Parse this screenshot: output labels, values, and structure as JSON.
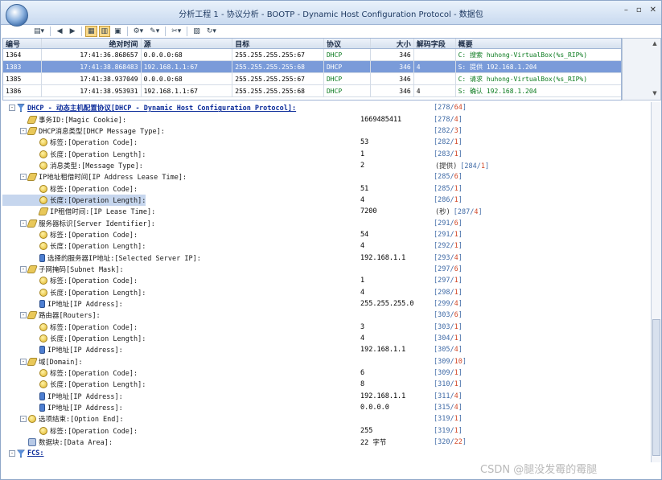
{
  "window": {
    "title": "分析工程 1 - 协议分析 - BOOTP - Dynamic Host Configuration Protocol - 数据包"
  },
  "packet_list": {
    "columns": [
      "编号",
      "绝对时间",
      "源",
      "目标",
      "协议",
      "大小",
      "解码字段",
      "概要"
    ],
    "rows": [
      {
        "no": "1364",
        "time": "17:41:36.868657",
        "src": "0.0.0.0:68",
        "dst": "255.255.255.255:67",
        "proto": "DHCP",
        "size": "346",
        "decode": "",
        "summary": "C: 搜索 huhong-VirtualBox(%s_RIP%)"
      },
      {
        "no": "1383",
        "time": "17:41:38.868483",
        "src": "192.168.1.1:67",
        "dst": "255.255.255.255:68",
        "proto": "DHCP",
        "size": "346",
        "decode": "4",
        "summary": "S: 提供 192.168.1.204",
        "selected": true
      },
      {
        "no": "1385",
        "time": "17:41:38.937049",
        "src": "0.0.0.0:68",
        "dst": "255.255.255.255:67",
        "proto": "DHCP",
        "size": "346",
        "decode": "",
        "summary": "C: 请求 huhong-VirtualBox(%s_RIP%)"
      },
      {
        "no": "1386",
        "time": "17:41:38.953931",
        "src": "192.168.1.1:67",
        "dst": "255.255.255.255:68",
        "proto": "DHCP",
        "size": "346",
        "decode": "4",
        "summary": "S: 确认 192.168.1.204"
      }
    ]
  },
  "tree": [
    {
      "lvl": 0,
      "exp": "-",
      "icon": "proto",
      "name": "DHCP - 动态主机配置协议[DHCP - Dynamic Host Configuration Protocol]:",
      "val": "",
      "unit": "",
      "off": "278",
      "len": "64",
      "top": true
    },
    {
      "lvl": 1,
      "exp": "",
      "icon": "tag",
      "name": "事务ID:[Magic Cookie]:",
      "val": "1669485411",
      "unit": "",
      "off": "278",
      "len": "4"
    },
    {
      "lvl": 1,
      "exp": "-",
      "icon": "tag",
      "name": "DHCP消息类型[DHCP Message Type]:",
      "val": "",
      "unit": "",
      "off": "282",
      "len": "3"
    },
    {
      "lvl": 2,
      "exp": "",
      "icon": "ball",
      "name": "标签:[Operation Code]:",
      "val": "53",
      "unit": "",
      "off": "282",
      "len": "1"
    },
    {
      "lvl": 2,
      "exp": "",
      "icon": "ball",
      "name": "长度:[Operation Length]:",
      "val": "1",
      "unit": "",
      "off": "283",
      "len": "1"
    },
    {
      "lvl": 2,
      "exp": "",
      "icon": "ball",
      "name": "消息类型:[Message Type]:",
      "val": "2",
      "unit": "(提供)",
      "off": "284",
      "len": "1"
    },
    {
      "lvl": 1,
      "exp": "-",
      "icon": "tag",
      "name": "IP地址租借时间[IP Address Lease Time]:",
      "val": "",
      "unit": "",
      "off": "285",
      "len": "6"
    },
    {
      "lvl": 2,
      "exp": "",
      "icon": "ball",
      "name": "标签:[Operation Code]:",
      "val": "51",
      "unit": "",
      "off": "285",
      "len": "1"
    },
    {
      "lvl": 2,
      "exp": "",
      "icon": "ball",
      "name": "长度:[Operation Length]:",
      "val": "4",
      "unit": "",
      "off": "286",
      "len": "1",
      "hl": true
    },
    {
      "lvl": 2,
      "exp": "",
      "icon": "tag",
      "name": "IP租借时间:[IP Lease Time]:",
      "val": "7200",
      "unit": "(秒)",
      "off": "287",
      "len": "4"
    },
    {
      "lvl": 1,
      "exp": "-",
      "icon": "tag",
      "name": "服务器标识[Server Identifier]:",
      "val": "",
      "unit": "",
      "off": "291",
      "len": "6"
    },
    {
      "lvl": 2,
      "exp": "",
      "icon": "ball",
      "name": "标签:[Operation Code]:",
      "val": "54",
      "unit": "",
      "off": "291",
      "len": "1"
    },
    {
      "lvl": 2,
      "exp": "",
      "icon": "ball",
      "name": "长度:[Operation Length]:",
      "val": "4",
      "unit": "",
      "off": "292",
      "len": "1"
    },
    {
      "lvl": 2,
      "exp": "",
      "icon": "ip",
      "name": "选择的服务器IP地址:[Selected Server IP]:",
      "val": "192.168.1.1",
      "unit": "",
      "off": "293",
      "len": "4"
    },
    {
      "lvl": 1,
      "exp": "-",
      "icon": "tag",
      "name": "子网掩码[Subnet Mask]:",
      "val": "",
      "unit": "",
      "off": "297",
      "len": "6"
    },
    {
      "lvl": 2,
      "exp": "",
      "icon": "ball",
      "name": "标签:[Operation Code]:",
      "val": "1",
      "unit": "",
      "off": "297",
      "len": "1"
    },
    {
      "lvl": 2,
      "exp": "",
      "icon": "ball",
      "name": "长度:[Operation Length]:",
      "val": "4",
      "unit": "",
      "off": "298",
      "len": "1"
    },
    {
      "lvl": 2,
      "exp": "",
      "icon": "ip",
      "name": "IP地址[IP Address]:",
      "val": "255.255.255.0",
      "unit": "",
      "off": "299",
      "len": "4"
    },
    {
      "lvl": 1,
      "exp": "-",
      "icon": "tag",
      "name": "路由器[Routers]:",
      "val": "",
      "unit": "",
      "off": "303",
      "len": "6"
    },
    {
      "lvl": 2,
      "exp": "",
      "icon": "ball",
      "name": "标签:[Operation Code]:",
      "val": "3",
      "unit": "",
      "off": "303",
      "len": "1"
    },
    {
      "lvl": 2,
      "exp": "",
      "icon": "ball",
      "name": "长度:[Operation Length]:",
      "val": "4",
      "unit": "",
      "off": "304",
      "len": "1"
    },
    {
      "lvl": 2,
      "exp": "",
      "icon": "ip",
      "name": "IP地址[IP Address]:",
      "val": "192.168.1.1",
      "unit": "",
      "off": "305",
      "len": "4"
    },
    {
      "lvl": 1,
      "exp": "-",
      "icon": "tag",
      "name": "域[Domain]:",
      "val": "",
      "unit": "",
      "off": "309",
      "len": "10"
    },
    {
      "lvl": 2,
      "exp": "",
      "icon": "ball",
      "name": "标签:[Operation Code]:",
      "val": "6",
      "unit": "",
      "off": "309",
      "len": "1"
    },
    {
      "lvl": 2,
      "exp": "",
      "icon": "ball",
      "name": "长度:[Operation Length]:",
      "val": "8",
      "unit": "",
      "off": "310",
      "len": "1"
    },
    {
      "lvl": 2,
      "exp": "",
      "icon": "ip",
      "name": "IP地址[IP Address]:",
      "val": "192.168.1.1",
      "unit": "",
      "off": "311",
      "len": "4"
    },
    {
      "lvl": 2,
      "exp": "",
      "icon": "ip",
      "name": "IP地址[IP Address]:",
      "val": "0.0.0.0",
      "unit": "",
      "off": "315",
      "len": "4"
    },
    {
      "lvl": 1,
      "exp": "-",
      "icon": "ball",
      "name": "选项结束:[Option End]:",
      "val": "",
      "unit": "",
      "off": "319",
      "len": "1"
    },
    {
      "lvl": 2,
      "exp": "",
      "icon": "ball",
      "name": "标签:[Operation Code]:",
      "val": "255",
      "unit": "",
      "off": "319",
      "len": "1"
    },
    {
      "lvl": 1,
      "exp": "",
      "icon": "data",
      "name": "数据块:[Data Area]:",
      "val": "22 字节",
      "unit": "",
      "off": "320",
      "len": "22"
    },
    {
      "lvl": 0,
      "exp": "-",
      "icon": "proto",
      "name": "FCS:",
      "val": "",
      "unit": "",
      "off": "",
      "len": "",
      "top": true
    }
  ],
  "watermark": "CSDN @腿没发霉的霉腿"
}
